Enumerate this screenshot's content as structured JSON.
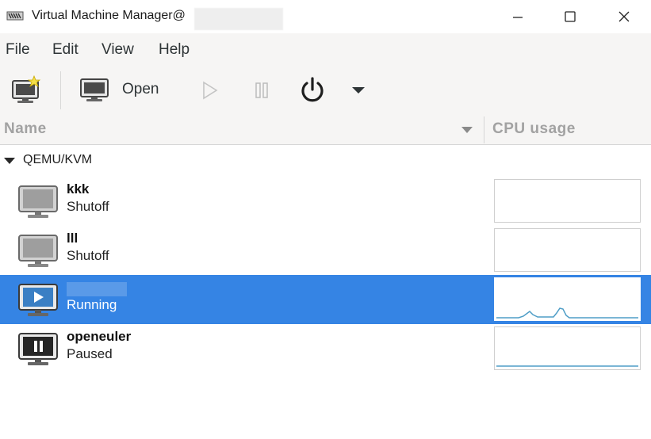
{
  "window": {
    "title": "Virtual Machine Manager@"
  },
  "menu": {
    "items": [
      "File",
      "Edit",
      "View",
      "Help"
    ]
  },
  "toolbar": {
    "open_label": "Open"
  },
  "columns": {
    "name": "Name",
    "cpu": "CPU usage"
  },
  "group": {
    "label": "QEMU/KVM"
  },
  "vms": [
    {
      "name": "kkk",
      "status": "Shutoff"
    },
    {
      "name": "lll",
      "status": "Shutoff"
    },
    {
      "name": "",
      "status": "Running"
    },
    {
      "name": "openeuler",
      "status": "Paused"
    }
  ],
  "colors": {
    "selection": "#3584e4",
    "cpu_line": "#4f9ec7"
  }
}
